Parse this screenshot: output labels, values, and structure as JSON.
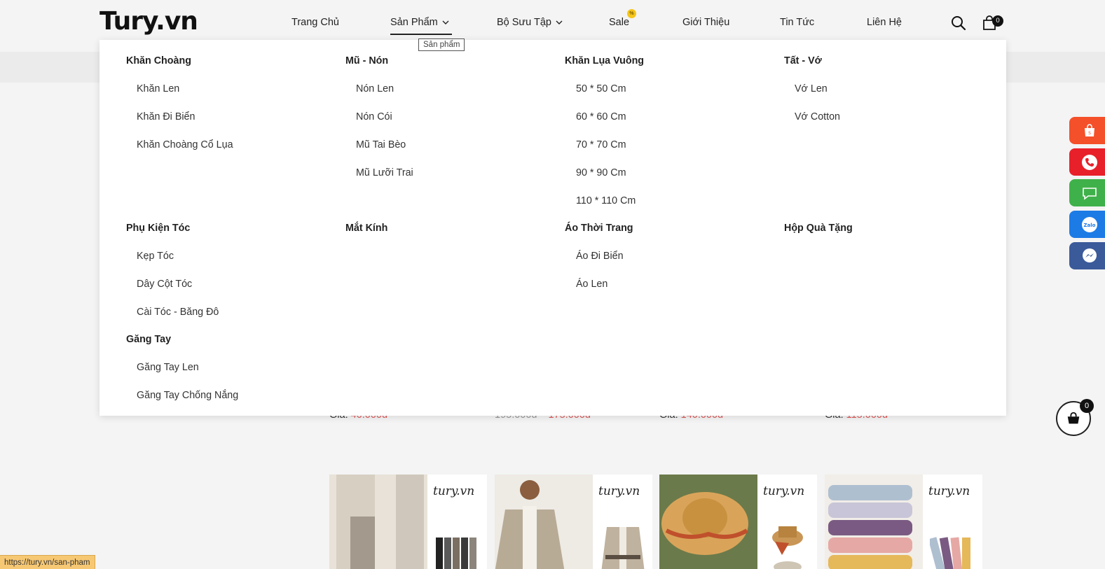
{
  "header": {
    "logo": "Tury.vn",
    "nav": [
      {
        "label": "Trang Chủ",
        "dropdown": false
      },
      {
        "label": "Sản Phẩm",
        "dropdown": true
      },
      {
        "label": "Bộ Sưu Tập",
        "dropdown": true
      },
      {
        "label": "Sale",
        "dropdown": false
      },
      {
        "label": "Giới Thiệu",
        "dropdown": false
      },
      {
        "label": "Tin Tức",
        "dropdown": false
      },
      {
        "label": "Liên Hệ",
        "dropdown": false
      }
    ],
    "sale_badge": "%",
    "tooltip": "Sản phẩm",
    "cart_count": "0"
  },
  "mega_menu": {
    "groups": [
      {
        "title": "Khăn Choàng",
        "items": [
          "Khăn Len",
          "Khăn Đi Biển",
          "Khăn Choàng Cổ Lụa"
        ]
      },
      {
        "title": "Mũ - Nón",
        "items": [
          "Nón Len",
          "Nón Cói",
          "Mũ Tai Bèo",
          "Mũ Lưỡi Trai"
        ]
      },
      {
        "title": "Khăn Lụa Vuông",
        "items": [
          "50 * 50 Cm",
          "60 * 60 Cm",
          "70 * 70 Cm",
          "90 * 90 Cm",
          "110 * 110 Cm"
        ]
      },
      {
        "title": "Tất - Vớ",
        "items": [
          "Vớ Len",
          "Vớ Cotton"
        ]
      },
      {
        "title": "Phụ Kiện Tóc",
        "items": [
          "Kẹp Tóc",
          "Dây Cột Tóc",
          "Cài Tóc - Băng Đô"
        ]
      },
      {
        "title": "Mắt Kính",
        "items": []
      },
      {
        "title": "Áo Thời Trang",
        "items": [
          "Áo Đi Biển",
          "Áo Len"
        ]
      },
      {
        "title": "Hộp Quà Tặng",
        "items": []
      },
      {
        "title": "Găng Tay",
        "items": [
          "Găng Tay Len",
          "Găng Tay Chống Nắng"
        ]
      }
    ]
  },
  "price_row": [
    {
      "label": "Giá:",
      "old": "",
      "price": "40.000đ"
    },
    {
      "label": "",
      "old": "195.000đ",
      "price": "175.000đ"
    },
    {
      "label": "Giá:",
      "old": "",
      "price": "140.000đ"
    },
    {
      "label": "Giá:",
      "old": "",
      "price": "115.000đ"
    }
  ],
  "cards": [
    {
      "brand": "tury.vn"
    },
    {
      "brand": "tury.vn"
    },
    {
      "brand": "tury.vn"
    },
    {
      "brand": "tury.vn"
    }
  ],
  "float_bar": {
    "shopee_label": "Shopee",
    "zalo_label": "Zalo"
  },
  "cart_float_count": "0",
  "status_url": "https://tury.vn/san-pham",
  "colors": {
    "shopee": "#f4502a",
    "phone": "#e8202a",
    "sms": "#3fb14a",
    "zalo": "#1d7be6",
    "messenger": "#3b5a9a",
    "price": "#e05a5a"
  }
}
